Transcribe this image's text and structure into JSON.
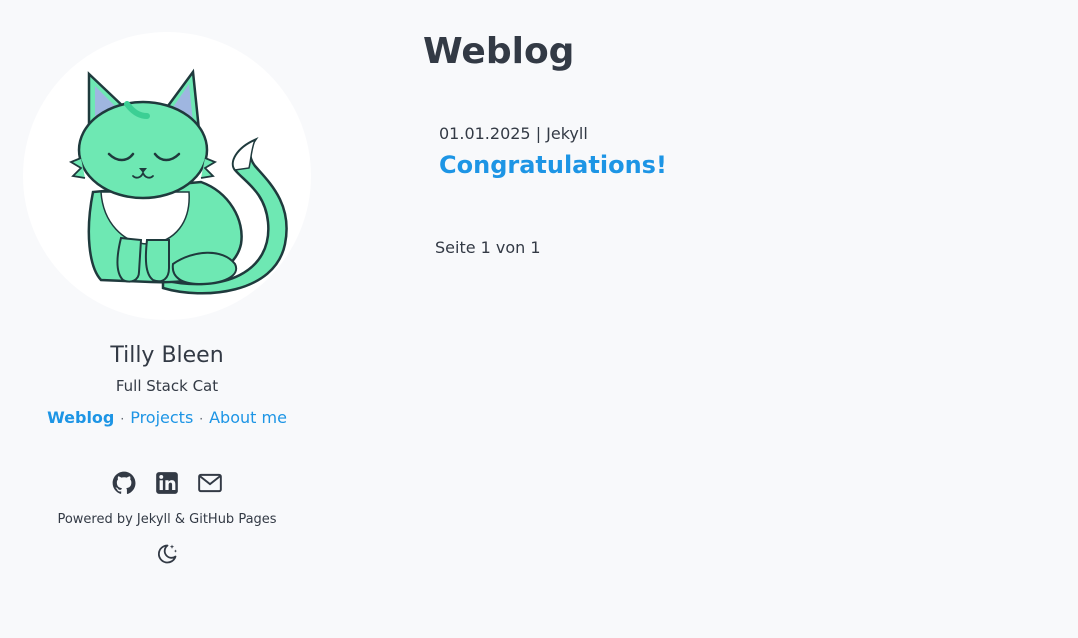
{
  "sidebar": {
    "name": "Tilly Bleen",
    "tagline": "Full Stack Cat",
    "nav": [
      {
        "label": "Weblog",
        "active": true
      },
      {
        "label": "Projects",
        "active": false
      },
      {
        "label": "About me",
        "active": false
      }
    ],
    "nav_separator": "·",
    "social_icons": [
      "github-icon",
      "linkedin-icon",
      "mail-icon"
    ],
    "powered_by": "Powered by Jekyll & GitHub Pages",
    "theme_toggle_icon": "moon-stars-icon"
  },
  "main": {
    "title": "Weblog",
    "posts": [
      {
        "meta": "01.01.2025 | Jekyll",
        "title": "Congratulations!"
      }
    ],
    "pagination": "Seite 1 von 1"
  },
  "colors": {
    "background": "#f8f9fb",
    "text": "#333a45",
    "link": "#1d95e5",
    "cat_body": "#6ee8b3",
    "cat_outline": "#1f3a3d"
  }
}
